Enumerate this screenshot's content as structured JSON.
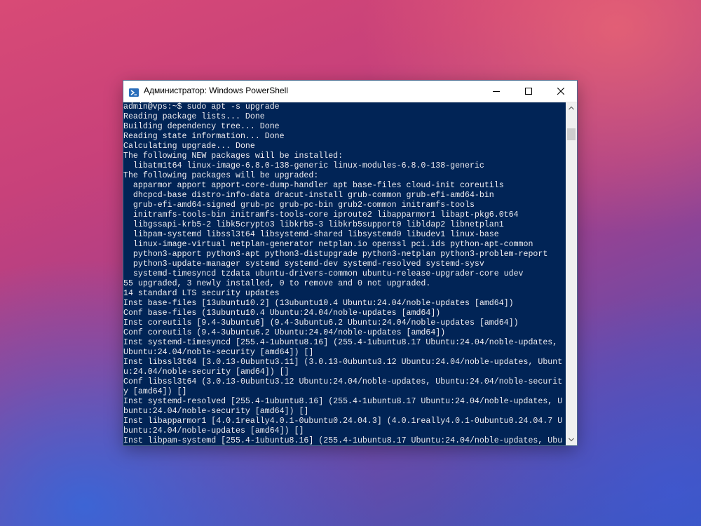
{
  "window": {
    "title": "Администратор: Windows PowerShell",
    "icon": "powershell-icon"
  },
  "controls": {
    "minimize": "minimize-icon",
    "maximize": "maximize-icon",
    "close": "close-icon"
  },
  "colors": {
    "console_background": "#012456",
    "console_text": "#eeedf0",
    "titlebar": "#ffffff"
  },
  "console": {
    "lines": [
      "admin@vps:~$ sudo apt -s upgrade",
      "Reading package lists... Done",
      "Building dependency tree... Done",
      "Reading state information... Done",
      "Calculating upgrade... Done",
      "The following NEW packages will be installed:",
      "  libatm1t64 linux-image-6.8.0-138-generic linux-modules-6.8.0-138-generic",
      "The following packages will be upgraded:",
      "  apparmor apport apport-core-dump-handler apt base-files cloud-init coreutils",
      "  dhcpcd-base distro-info-data dracut-install grub-common grub-efi-amd64-bin",
      "  grub-efi-amd64-signed grub-pc grub-pc-bin grub2-common initramfs-tools",
      "  initramfs-tools-bin initramfs-tools-core iproute2 libapparmor1 libapt-pkg6.0t64",
      "  libgssapi-krb5-2 libk5crypto3 libkrb5-3 libkrb5support0 libldap2 libnetplan1",
      "  libpam-systemd libssl3t64 libsystemd-shared libsystemd0 libudev1 linux-base",
      "  linux-image-virtual netplan-generator netplan.io openssl pci.ids python-apt-common",
      "  python3-apport python3-apt python3-distupgrade python3-netplan python3-problem-report",
      "  python3-update-manager systemd systemd-dev systemd-resolved systemd-sysv",
      "  systemd-timesyncd tzdata ubuntu-drivers-common ubuntu-release-upgrader-core udev",
      "55 upgraded, 3 newly installed, 0 to remove and 0 not upgraded.",
      "14 standard LTS security updates",
      "Inst base-files [13ubuntu10.2] (13ubuntu10.4 Ubuntu:24.04/noble-updates [amd64])",
      "Conf base-files (13ubuntu10.4 Ubuntu:24.04/noble-updates [amd64])",
      "Inst coreutils [9.4-3ubuntu6] (9.4-3ubuntu6.2 Ubuntu:24.04/noble-updates [amd64])",
      "Conf coreutils (9.4-3ubuntu6.2 Ubuntu:24.04/noble-updates [amd64])",
      "Inst systemd-timesyncd [255.4-1ubuntu8.16] (255.4-1ubuntu8.17 Ubuntu:24.04/noble-updates,",
      "Ubuntu:24.04/noble-security [amd64]) []",
      "Inst libssl3t64 [3.0.13-0ubuntu3.11] (3.0.13-0ubuntu3.12 Ubuntu:24.04/noble-updates, Ubunt",
      "u:24.04/noble-security [amd64]) []",
      "Conf libssl3t64 (3.0.13-0ubuntu3.12 Ubuntu:24.04/noble-updates, Ubuntu:24.04/noble-securit",
      "y [amd64]) []",
      "Inst systemd-resolved [255.4-1ubuntu8.16] (255.4-1ubuntu8.17 Ubuntu:24.04/noble-updates, U",
      "buntu:24.04/noble-security [amd64]) []",
      "Inst libapparmor1 [4.0.1really4.0.1-0ubuntu0.24.04.3] (4.0.1really4.0.1-0ubuntu0.24.04.7 U",
      "buntu:24.04/noble-updates [amd64]) []",
      "Inst libpam-systemd [255.4-1ubuntu8.16] (255.4-1ubuntu8.17 Ubuntu:24.04/noble-updates, Ubu"
    ]
  }
}
